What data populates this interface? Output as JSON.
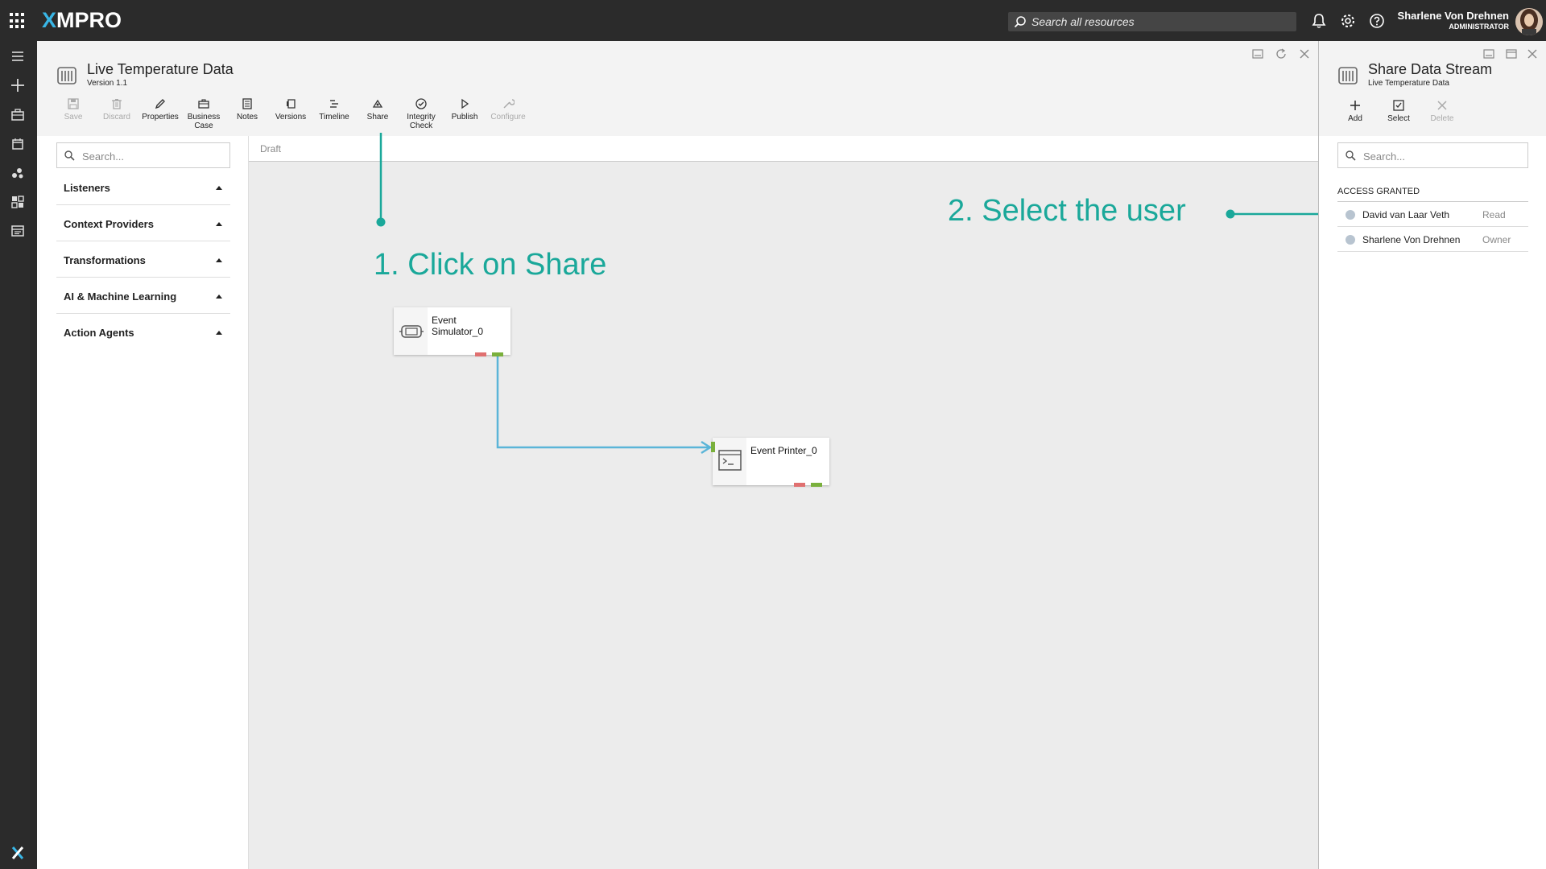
{
  "app": {
    "logo": "XMPRO",
    "logo_x": "X",
    "logo_rest": "MPRO",
    "search_placeholder": "Search all resources",
    "user_name": "Sharlene Von Drehnen",
    "user_role": "ADMINISTRATOR"
  },
  "document": {
    "title": "Live Temperature Data",
    "version": "Version 1.1",
    "status": "Draft"
  },
  "toolbar": {
    "buttons": [
      {
        "label": "Save",
        "icon": "save-icon",
        "enabled": false
      },
      {
        "label": "Discard",
        "icon": "trash-icon",
        "enabled": false
      },
      {
        "label": "Properties",
        "icon": "pencil-icon",
        "enabled": true
      },
      {
        "label": "Business Case",
        "icon": "briefcase-icon",
        "enabled": true
      },
      {
        "label": "Notes",
        "icon": "notes-icon",
        "enabled": true
      },
      {
        "label": "Versions",
        "icon": "versions-icon",
        "enabled": true
      },
      {
        "label": "Timeline",
        "icon": "timeline-icon",
        "enabled": true
      },
      {
        "label": "Share",
        "icon": "share-icon",
        "enabled": true
      },
      {
        "label": "Integrity Check",
        "icon": "check-circle-icon",
        "enabled": true
      },
      {
        "label": "Publish",
        "icon": "play-icon",
        "enabled": true
      },
      {
        "label": "Configure",
        "icon": "wrench-icon",
        "enabled": false
      }
    ]
  },
  "toolbox": {
    "search_placeholder": "Search...",
    "categories": [
      "Listeners",
      "Context Providers",
      "Transformations",
      "AI & Machine Learning",
      "Action Agents"
    ]
  },
  "canvas": {
    "nodes": [
      {
        "title": "Event Simulator_0",
        "icon": "simulator-icon"
      },
      {
        "title": "Event Printer_0",
        "icon": "terminal-icon"
      }
    ]
  },
  "annotations": {
    "step1": "1. Click on Share",
    "step2": "2. Select the user",
    "color": "#1aa89a"
  },
  "share_panel": {
    "title": "Share Data Stream",
    "subtitle": "Live Temperature Data",
    "buttons": [
      {
        "label": "Add",
        "icon": "plus-icon",
        "enabled": true
      },
      {
        "label": "Select",
        "icon": "checkbox-icon",
        "enabled": true
      },
      {
        "label": "Delete",
        "icon": "close-icon",
        "enabled": false
      }
    ],
    "search_placeholder": "Search...",
    "access_heading": "ACCESS GRANTED",
    "users": [
      {
        "name": "David van Laar Veth",
        "role": "Read"
      },
      {
        "name": "Sharlene Von Drehnen",
        "role": "Owner"
      }
    ]
  }
}
